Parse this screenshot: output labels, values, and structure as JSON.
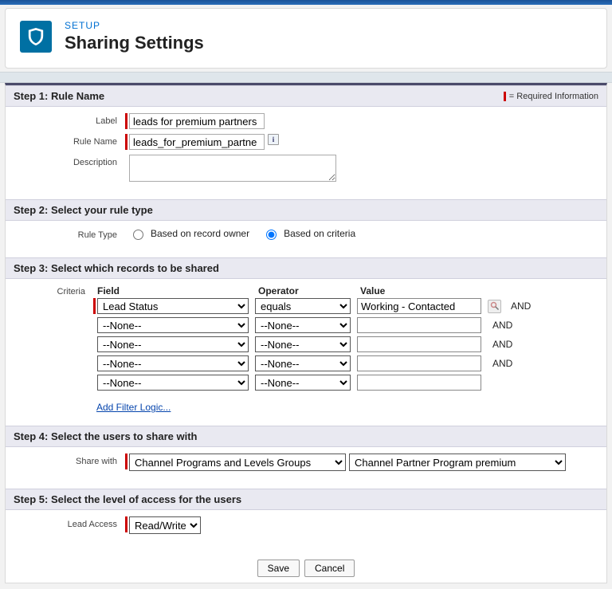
{
  "header": {
    "eyebrow": "SETUP",
    "title": "Sharing Settings"
  },
  "step1": {
    "title": "Step 1: Rule Name",
    "required_info": "= Required Information",
    "label_field": "Label",
    "label_value": "leads for premium partners",
    "rulename_field": "Rule Name",
    "rulename_value": "leads_for_premium_partne",
    "description_field": "Description",
    "description_value": ""
  },
  "step2": {
    "title": "Step 2: Select your rule type",
    "ruletype_field": "Rule Type",
    "option_owner": "Based on record owner",
    "option_criteria": "Based on criteria"
  },
  "step3": {
    "title": "Step 3: Select which records to be shared",
    "criteria_label": "Criteria",
    "col_field": "Field",
    "col_operator": "Operator",
    "col_value": "Value",
    "and": "AND",
    "rows": [
      {
        "field": "Lead Status",
        "operator": "equals",
        "value": "Working - Contacted",
        "required": true,
        "lookup": true,
        "and": true
      },
      {
        "field": "--None--",
        "operator": "--None--",
        "value": "",
        "required": false,
        "lookup": false,
        "and": true
      },
      {
        "field": "--None--",
        "operator": "--None--",
        "value": "",
        "required": false,
        "lookup": false,
        "and": true
      },
      {
        "field": "--None--",
        "operator": "--None--",
        "value": "",
        "required": false,
        "lookup": false,
        "and": true
      },
      {
        "field": "--None--",
        "operator": "--None--",
        "value": "",
        "required": false,
        "lookup": false,
        "and": false
      }
    ],
    "add_filter": "Add Filter Logic..."
  },
  "step4": {
    "title": "Step 4: Select the users to share with",
    "sharewith_field": "Share with",
    "category": "Channel Programs and Levels Groups",
    "value": "Channel Partner Program premium"
  },
  "step5": {
    "title": "Step 5: Select the level of access for the users",
    "access_field": "Lead Access",
    "access_value": "Read/Write"
  },
  "buttons": {
    "save": "Save",
    "cancel": "Cancel"
  }
}
